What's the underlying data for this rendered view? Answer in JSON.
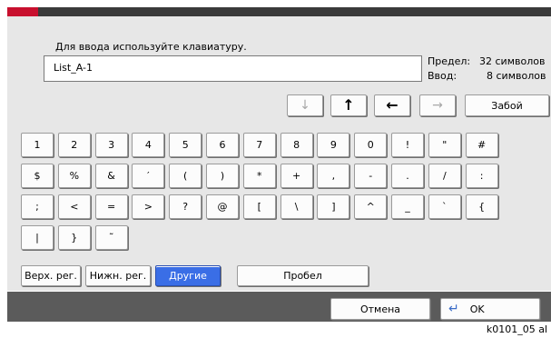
{
  "instruction": "Для ввода используйте клавиатуру.",
  "input_value": "List_A-1",
  "limit": {
    "label": "Предел:",
    "value": "32 символов"
  },
  "entered": {
    "label": "Ввод:",
    "value": "8 символов"
  },
  "nav": {
    "down_icon": "arrow-down-icon",
    "up_icon": "arrow-up-icon",
    "left_icon": "arrow-left-icon",
    "right_icon": "arrow-right-icon",
    "backspace_label": "Забой"
  },
  "rows": [
    [
      "1",
      "2",
      "3",
      "4",
      "5",
      "6",
      "7",
      "8",
      "9",
      "0",
      "!",
      "\"",
      "#"
    ],
    [
      "$",
      "%",
      "&",
      "′",
      "(",
      ")",
      "*",
      "+",
      ",",
      "-",
      ".",
      "/",
      ":"
    ],
    [
      ";",
      "<",
      "=",
      ">",
      "?",
      "@",
      "[",
      "\\",
      "]",
      "^",
      "_",
      "`",
      "{"
    ],
    [
      "|",
      "}",
      "˜"
    ]
  ],
  "modes": {
    "upper": "Верх. рег.",
    "lower": "Нижн. рег.",
    "other": "Другие"
  },
  "space_label": "Пробел",
  "cancel_label": "Отмена",
  "ok_label": "OK",
  "ok_icon": "enter-arrow-icon",
  "footer_id": "k0101_05 al",
  "colors": {
    "active": "#3a6ee6",
    "titlebar": "#3a3a3a",
    "accent": "#c8102e"
  }
}
